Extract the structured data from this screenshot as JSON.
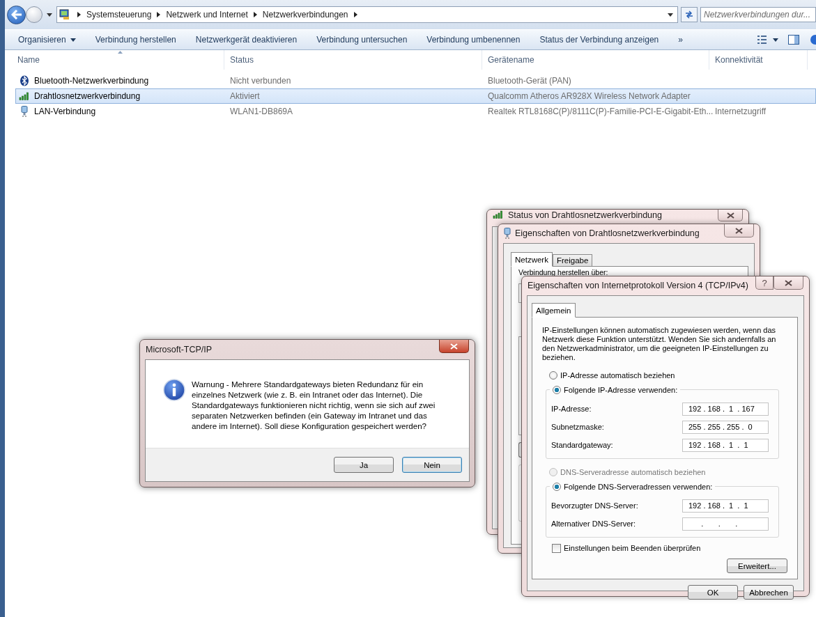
{
  "address_bar": {
    "breadcrumbs": [
      "Systemsteuerung",
      "Netzwerk und Internet",
      "Netzwerkverbindungen"
    ],
    "search_placeholder": "Netzwerkverbindungen dur..."
  },
  "toolbar": {
    "items": [
      {
        "label": "Organisieren",
        "kind": "menu"
      },
      {
        "label": "Verbindung herstellen",
        "kind": "button"
      },
      {
        "label": "Netzwerkgerät deaktivieren",
        "kind": "button"
      },
      {
        "label": "Verbindung untersuchen",
        "kind": "button"
      },
      {
        "label": "Verbindung umbenennen",
        "kind": "button"
      },
      {
        "label": "Status der Verbindung anzeigen",
        "kind": "button"
      }
    ],
    "overflow": "»"
  },
  "columns": [
    {
      "label": "Name",
      "sorted": true
    },
    {
      "label": "Status",
      "sorted": false
    },
    {
      "label": "Gerätename",
      "sorted": false
    },
    {
      "label": "Konnektivität",
      "sorted": false
    }
  ],
  "rows": [
    {
      "kind": "bluetooth",
      "name": "Bluetooth-Netzwerkverbindung",
      "status": "Nicht verbunden",
      "device": "Bluetooth-Gerät (PAN)",
      "selected": false
    },
    {
      "kind": "wireless",
      "name": "Drahtlosnetzwerkverbindung",
      "status": "Aktiviert",
      "device": "Qualcomm Atheros AR928X Wireless Network Adapter",
      "selected": true
    },
    {
      "kind": "lan",
      "name": "LAN-Verbindung",
      "status": "WLAN1-DB869A",
      "device": "Realtek RTL8168C(P)/8111C(P)-Familie-PCI-E-Gigabit-Eth...",
      "connectivity": "Internetzugriff",
      "selected": false
    }
  ],
  "status_window": {
    "title": "Status von Drahtlosnetzwerkverbindung"
  },
  "properties_window": {
    "title": "Eigenschaften von Drahtlosnetzwerkverbindung",
    "tabs": [
      {
        "label": "Netzwerk",
        "selected": true
      },
      {
        "label": "Freigabe",
        "selected": false
      }
    ],
    "connect_label": "Verbindung herstellen über:"
  },
  "ipv4_dialog": {
    "title": "Eigenschaften von Internetprotokoll Version 4 (TCP/IPv4)",
    "help": "?",
    "tabs": [
      {
        "label": "Allgemein",
        "selected": true
      }
    ],
    "intro": "IP-Einstellungen können automatisch zugewiesen werden, wenn das Netzwerk diese Funktion unterstützt. Wenden Sie sich andernfalls an den Netzwerkadministrator, um die geeigneten IP-Einstellungen zu beziehen.",
    "groups": [
      {
        "auto": {
          "label": "IP-Adresse automatisch beziehen",
          "selected": false,
          "disabled": false
        },
        "manual": {
          "label": "Folgende IP-Adresse verwenden:",
          "selected": true,
          "disabled": false
        },
        "fields": [
          {
            "label": "IP-Adresse:",
            "value": "192 . 168 .  1  . 167"
          },
          {
            "label": "Subnetzmaske:",
            "value": "255 . 255 . 255 .  0"
          },
          {
            "label": "Standardgateway:",
            "value": "192 . 168 .  1  .  1"
          }
        ]
      },
      {
        "auto": {
          "label": "DNS-Serveradresse automatisch beziehen",
          "selected": false,
          "disabled": true
        },
        "manual": {
          "label": "Folgende DNS-Serveradressen verwenden:",
          "selected": true,
          "disabled": false
        },
        "fields": [
          {
            "label": "Bevorzugter DNS-Server:",
            "value": "192 . 168 .  1  .  1"
          },
          {
            "label": "Alternativer DNS-Server:",
            "value": "      .       .       .      "
          }
        ]
      }
    ],
    "validate": {
      "label": "Einstellungen beim Beenden überprüfen",
      "checked": false
    },
    "advanced_button": "Erweitert...",
    "buttons": [
      "OK",
      "Abbrechen"
    ]
  },
  "message_box": {
    "title": "Microsoft-TCP/IP",
    "text": "Warnung - Mehrere Standardgateways bieten Redundanz für ein einzelnes Netzwerk (wie z. B. ein Intranet oder das Internet). Die Standardgateways funktionieren nicht richtig, wenn sie sich auf zwei separaten Netzwerken befinden (ein Gateway im Intranet und das andere im Internet). Soll diese Konfiguration gespeichert werden?",
    "buttons": [
      {
        "label": "Ja",
        "default": false
      },
      {
        "label": "Nein",
        "default": true
      }
    ]
  }
}
